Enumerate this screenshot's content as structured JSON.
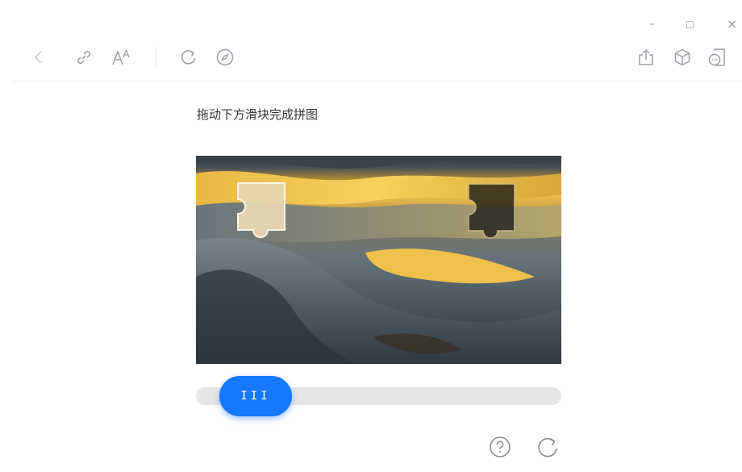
{
  "window_controls": {
    "minimize": "–",
    "maximize": "☐",
    "close": "×"
  },
  "toolbar": {
    "left_icons": [
      "back-icon",
      "link-icon",
      "font-size-icon",
      "refresh-icon",
      "compass-icon"
    ],
    "right_icons": [
      "share-icon",
      "cube-icon",
      "more-icon"
    ]
  },
  "captcha": {
    "instruction": "拖动下方滑块完成拼图",
    "slider": {
      "handle_label": "III",
      "accent": "#1677ff",
      "progress": 0.08
    },
    "bottom_icons": [
      "help-icon",
      "refresh-captcha-icon"
    ]
  }
}
